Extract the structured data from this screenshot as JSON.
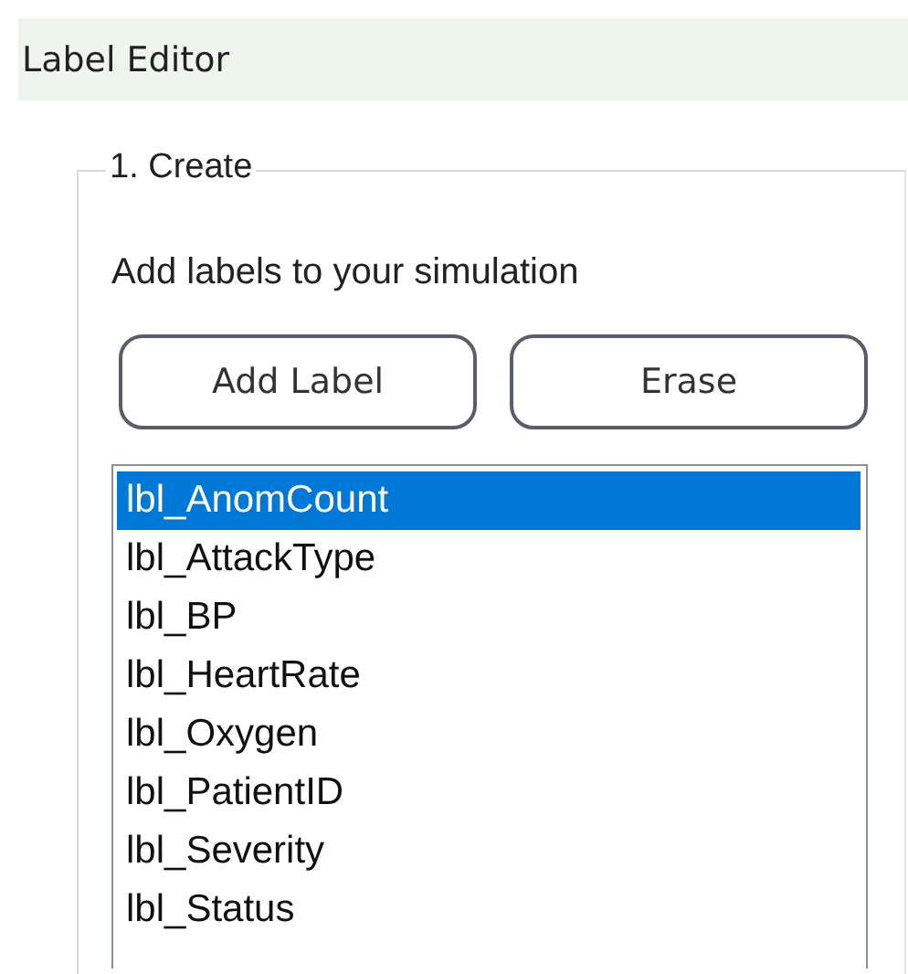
{
  "window": {
    "title": "Label Editor"
  },
  "group": {
    "legend": "1. Create",
    "description": "Add labels to your simulation",
    "buttons": [
      "Add Label",
      "Erase"
    ],
    "labels": [
      {
        "text": "lbl_AnomCount",
        "selected": true
      },
      {
        "text": "lbl_AttackType",
        "selected": false
      },
      {
        "text": "lbl_BP",
        "selected": false
      },
      {
        "text": "lbl_HeartRate",
        "selected": false
      },
      {
        "text": "lbl_Oxygen",
        "selected": false
      },
      {
        "text": "lbl_PatientID",
        "selected": false
      },
      {
        "text": "lbl_Severity",
        "selected": false
      },
      {
        "text": "lbl_Status",
        "selected": false
      }
    ]
  }
}
